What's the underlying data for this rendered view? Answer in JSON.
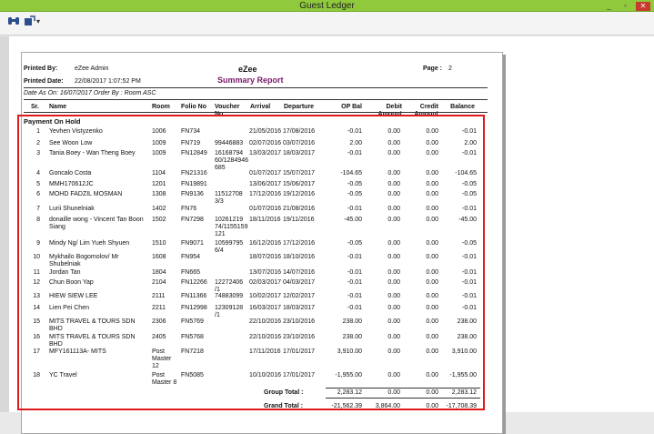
{
  "window": {
    "title": "Guest Ledger",
    "buttons": [
      "_",
      "▫",
      "✕"
    ]
  },
  "toolbar": {
    "icons": [
      "binoculars-icon",
      "export-icon"
    ],
    "dropdown_caret": "▾"
  },
  "report": {
    "printed_by_label": "Printed By:",
    "printed_by_value": "eZee Admin",
    "printed_date_label": "Printed Date:",
    "printed_date_value": "22/08/2017 1:07:52 PM",
    "brand": "eZee",
    "title": "Summary Report",
    "page_label": "Page :",
    "page_value": "2",
    "subheader": "Date As On: 16/07/2017 Order By : Room ASC",
    "columns": [
      "Sr.",
      "Name",
      "Room",
      "Folio No",
      "Voucher No",
      "Arrival",
      "Departure",
      "OP Bal",
      "Debit Amount",
      "Credit Amount",
      "Balance"
    ],
    "group_name": "Payment On Hold",
    "rows": [
      {
        "sr": "1",
        "name": "Yevhen Vistyzenko",
        "room": "1006",
        "folio": "FN734",
        "voucher": "",
        "arrival": "21/05/2016",
        "departure": "17/08/2016",
        "op": "-0.01",
        "debit": "0.00",
        "credit": "0.00",
        "balance": "-0.01"
      },
      {
        "sr": "2",
        "name": "See Woon Low",
        "room": "1009",
        "folio": "FN719",
        "voucher": "99446883",
        "arrival": "02/07/2016",
        "departure": "03/07/2016",
        "op": "2.00",
        "debit": "0.00",
        "credit": "0.00",
        "balance": "2.00"
      },
      {
        "sr": "3",
        "name": "Tania Boey - Wan Theng Boey",
        "room": "1009",
        "folio": "FN12849",
        "voucher": "16168794 60/1284946 685",
        "arrival": "13/03/2017",
        "departure": "18/03/2017",
        "op": "-0.01",
        "debit": "0.00",
        "credit": "0.00",
        "balance": "-0.01"
      },
      {
        "sr": "4",
        "name": "Goncalo Costa",
        "room": "1104",
        "folio": "FN21316",
        "voucher": "",
        "arrival": "01/07/2017",
        "departure": "15/07/2017",
        "op": "-104.65",
        "debit": "0.00",
        "credit": "0.00",
        "balance": "-104.65"
      },
      {
        "sr": "5",
        "name": "MMH170612JC",
        "room": "1201",
        "folio": "FN19891",
        "voucher": "",
        "arrival": "13/06/2017",
        "departure": "15/06/2017",
        "op": "-0.05",
        "debit": "0.00",
        "credit": "0.00",
        "balance": "-0.05"
      },
      {
        "sr": "6",
        "name": "MOHD FADZIL MOSMAN",
        "room": "1308",
        "folio": "FN9136",
        "voucher": "11512708 3/3",
        "arrival": "17/12/2016",
        "departure": "19/12/2016",
        "op": "-0.05",
        "debit": "0.00",
        "credit": "0.00",
        "balance": "-0.05"
      },
      {
        "sr": "7",
        "name": "Lurii Shunelniak",
        "room": "1402",
        "folio": "FN76",
        "voucher": "",
        "arrival": "01/07/2016",
        "departure": "21/08/2016",
        "op": "-0.01",
        "debit": "0.00",
        "credit": "0.00",
        "balance": "-0.01"
      },
      {
        "sr": "8",
        "name": "donaille wong - Vincent Tan Boon Siang",
        "room": "1502",
        "folio": "FN7298",
        "voucher": "10261219 74/1155159 121",
        "arrival": "18/11/2016",
        "departure": "19/11/2016",
        "op": "-45.00",
        "debit": "0.00",
        "credit": "0.00",
        "balance": "-45.00"
      },
      {
        "sr": "9",
        "name": "Mindy Ng/ Lim Yueh Shyuen",
        "room": "1510",
        "folio": "FN9071",
        "voucher": "10599795 6/4",
        "arrival": "16/12/2016",
        "departure": "17/12/2016",
        "op": "-0.05",
        "debit": "0.00",
        "credit": "0.00",
        "balance": "-0.05"
      },
      {
        "sr": "10",
        "name": "Mykhailo Bogomolov/ Mr Shubelniak",
        "room": "1608",
        "folio": "FN954",
        "voucher": "",
        "arrival": "18/07/2016",
        "departure": "18/10/2016",
        "op": "-0.01",
        "debit": "0.00",
        "credit": "0.00",
        "balance": "-0.01"
      },
      {
        "sr": "11",
        "name": "Jordan Tan",
        "room": "1804",
        "folio": "FN665",
        "voucher": "",
        "arrival": "13/07/2016",
        "departure": "14/07/2016",
        "op": "-0.01",
        "debit": "0.00",
        "credit": "0.00",
        "balance": "-0.01"
      },
      {
        "sr": "12",
        "name": "Chun Boon Yap",
        "room": "2104",
        "folio": "FN12266",
        "voucher": "12272406 /1",
        "arrival": "02/03/2017",
        "departure": "04/03/2017",
        "op": "-0.01",
        "debit": "0.00",
        "credit": "0.00",
        "balance": "-0.01"
      },
      {
        "sr": "13",
        "name": "HIEW SIEW LEE",
        "room": "2111",
        "folio": "FN11366",
        "voucher": "74883099",
        "arrival": "10/02/2017",
        "departure": "12/02/2017",
        "op": "-0.01",
        "debit": "0.00",
        "credit": "0.00",
        "balance": "-0.01"
      },
      {
        "sr": "14",
        "name": "Lien Pei Chen",
        "room": "2211",
        "folio": "FN12998",
        "voucher": "12309128 /1",
        "arrival": "16/03/2017",
        "departure": "18/03/2017",
        "op": "-0.01",
        "debit": "0.00",
        "credit": "0.00",
        "balance": "-0.01"
      },
      {
        "sr": "15",
        "name": "MITS TRAVEL & TOURS SDN BHD",
        "room": "2306",
        "folio": "FN5769",
        "voucher": "",
        "arrival": "22/10/2016",
        "departure": "23/10/2016",
        "op": "238.00",
        "debit": "0.00",
        "credit": "0.00",
        "balance": "238.00"
      },
      {
        "sr": "16",
        "name": "MITS TRAVEL & TOURS SDN BHD",
        "room": "2405",
        "folio": "FN5768",
        "voucher": "",
        "arrival": "22/10/2016",
        "departure": "23/10/2016",
        "op": "238.00",
        "debit": "0.00",
        "credit": "0.00",
        "balance": "238.00"
      },
      {
        "sr": "17",
        "name": "MFY161113A- MITS",
        "room": "Post Master 12",
        "folio": "FN7218",
        "voucher": "",
        "arrival": "17/11/2016",
        "departure": "17/01/2017",
        "op": "3,910.00",
        "debit": "0.00",
        "credit": "0.00",
        "balance": "3,910.00"
      },
      {
        "sr": "18",
        "name": "YC Travel",
        "room": "Post Master 8",
        "folio": "FN5085",
        "voucher": "",
        "arrival": "10/10/2016",
        "departure": "17/01/2017",
        "op": "-1,955.00",
        "debit": "0.00",
        "credit": "0.00",
        "balance": "-1,955.00"
      }
    ],
    "group_total_label": "Group Total :",
    "group_total": {
      "op": "2,283.12",
      "debit": "0.00",
      "credit": "0.00",
      "balance": "2,283.12"
    },
    "grand_total_label": "Grand Total :",
    "grand_total": {
      "op": "-21,562.39",
      "debit": "3,864.00",
      "credit": "0.00",
      "balance": "-17,708.39"
    }
  },
  "colors": {
    "title_bar": "#8fca3c",
    "report_title": "#7a1a6a",
    "highlight_box": "#e01a1a"
  }
}
